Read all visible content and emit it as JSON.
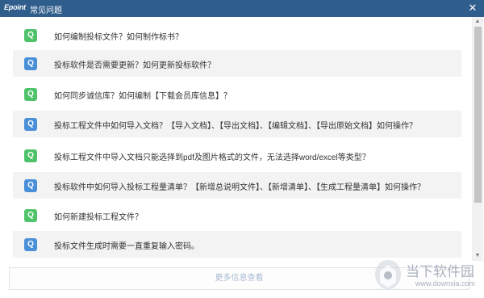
{
  "window": {
    "logo": "Epoint",
    "title": "常见问题",
    "close": "✕"
  },
  "faq": [
    {
      "icon": "Q",
      "color": "green",
      "text": "如何编制投标文件？如何制作标书？"
    },
    {
      "icon": "Q",
      "color": "blue",
      "text": "投标软件是否需要更新？如何更新投标软件？"
    },
    {
      "icon": "Q",
      "color": "green",
      "text": "如何同步诚信库？如何编制【下载会员库信息】？"
    },
    {
      "icon": "Q",
      "color": "blue",
      "text": "投标工程文件中如何导入文档？【导入文档】、【导出文档】、【编辑文档】、【导出原始文档】如何操作？"
    },
    {
      "icon": "Q",
      "color": "green",
      "text": "投标工程文件中导入文档只能选择到pdf及图片格式的文件，无法选择word/excel等类型？"
    },
    {
      "icon": "Q",
      "color": "blue",
      "text": "投标软件中如何导入投标工程量清单？【新增总说明文件】、【新增清单】、【生成工程量清单】如何操作？"
    },
    {
      "icon": "Q",
      "color": "green",
      "text": "如何新建投标工程文件？"
    },
    {
      "icon": "Q",
      "color": "blue",
      "text": "投标文件生成时需要一直重复输入密码。"
    }
  ],
  "footer": {
    "more_label": "更多信息查看"
  },
  "watermark": {
    "brand": "当下软件园",
    "url": "www.downxia.com"
  },
  "colors": {
    "titlebar": "#2f5d8c",
    "green": "#4fc36a",
    "blue": "#4a90d9"
  }
}
